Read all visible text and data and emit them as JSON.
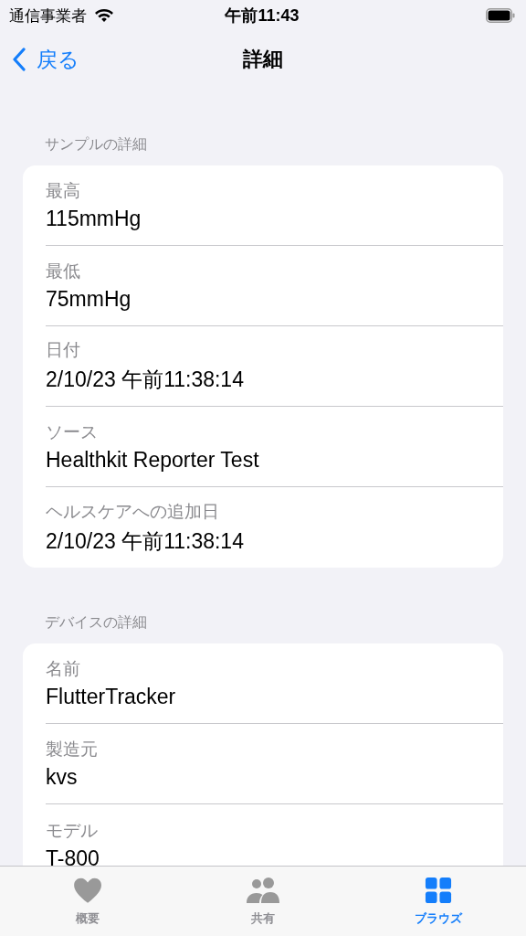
{
  "status_bar": {
    "carrier": "通信事業者",
    "time": "午前11:43"
  },
  "nav_bar": {
    "back": "戻る",
    "title": "詳細"
  },
  "sections": [
    {
      "header": "サンプルの詳細",
      "rows": [
        {
          "label": "最高",
          "value": "115mmHg"
        },
        {
          "label": "最低",
          "value": "75mmHg"
        },
        {
          "label": "日付",
          "value": "2/10/23 午前11:38:14"
        },
        {
          "label": "ソース",
          "value": "Healthkit Reporter Test"
        },
        {
          "label": "ヘルスケアへの追加日",
          "value": "2/10/23 午前11:38:14"
        }
      ]
    },
    {
      "header": "デバイスの詳細",
      "rows": [
        {
          "label": "名前",
          "value": "FlutterTracker"
        },
        {
          "label": "製造元",
          "value": "kvs"
        },
        {
          "label": "モデル",
          "value": "T-800"
        }
      ]
    }
  ],
  "tab_bar": [
    {
      "label": "概要",
      "kind": "heart",
      "selected": false
    },
    {
      "label": "共有",
      "kind": "people",
      "selected": false
    },
    {
      "label": "ブラウズ",
      "kind": "grid",
      "selected": true
    }
  ]
}
